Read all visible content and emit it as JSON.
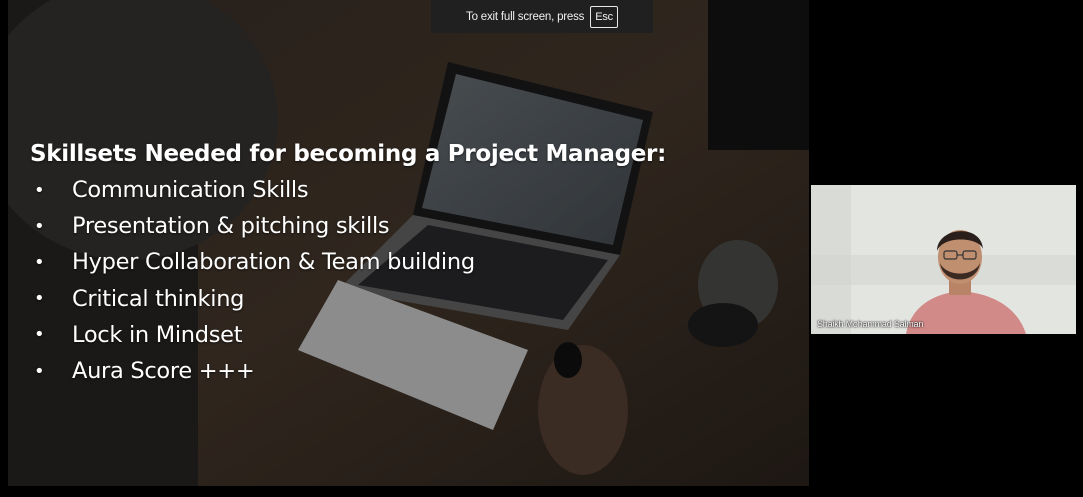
{
  "fullscreen_notice": {
    "message": "To exit full screen, press",
    "key_label": "Esc"
  },
  "slide": {
    "title": "Skillsets Needed for becoming a Project Manager:",
    "bullet_symbol": "•",
    "bullets": [
      "Communication Skills",
      "Presentation & pitching skills",
      "Hyper Collaboration & Team building",
      "Critical thinking",
      "Lock in Mindset",
      "Aura Score +++"
    ]
  },
  "participant": {
    "name": "Shaikh Mohammad Salman"
  },
  "colors": {
    "background": "#000000",
    "notice_bar": "#202020",
    "slide_text": "#ffffff"
  }
}
